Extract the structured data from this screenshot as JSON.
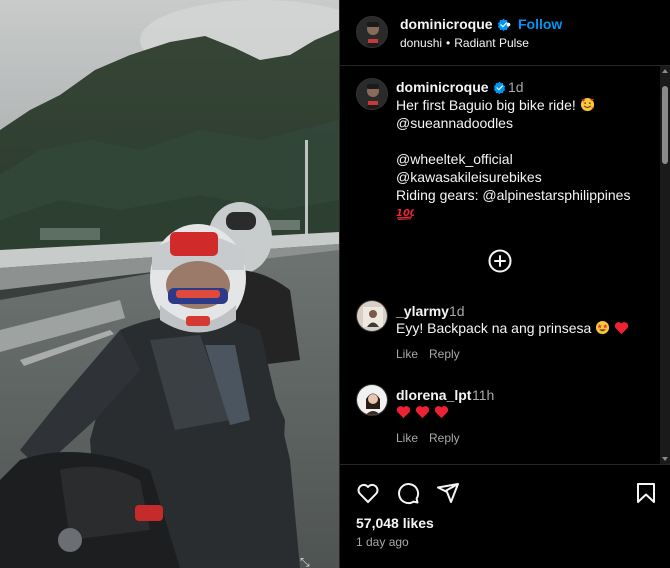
{
  "post": {
    "author": "dominicroque",
    "follow_label": "Follow",
    "location": "donushi",
    "audio": "Radiant Pulse",
    "separator": "•"
  },
  "caption": {
    "author": "dominicroque",
    "time": "1d",
    "lines": [
      "Her first Baguio big bike ride!",
      "@sueannadoodles",
      "",
      "@wheeltek_official",
      "@kawasakileisurebikes",
      "Riding gears: @alpinestarsphilippines"
    ]
  },
  "comments": [
    {
      "user": "_ylarmy",
      "time": "1d",
      "text": "Eyy! Backpack na ang prinsesa",
      "like_label": "Like",
      "reply_label": "Reply"
    },
    {
      "user": "dlorena_lpt",
      "time": "11h",
      "text": "",
      "like_label": "Like",
      "reply_label": "Reply"
    }
  ],
  "footer": {
    "likes": "57,048 likes",
    "posted": "1 day ago"
  },
  "colors": {
    "background": "#000000",
    "accent": "#0095f6",
    "muted": "#a8a8a8",
    "heart": "#ed2232"
  },
  "icons": [
    "verified-badge-icon",
    "add-comment-icon",
    "like-heart-icon",
    "comment-bubble-icon",
    "share-send-icon",
    "bookmark-icon"
  ]
}
